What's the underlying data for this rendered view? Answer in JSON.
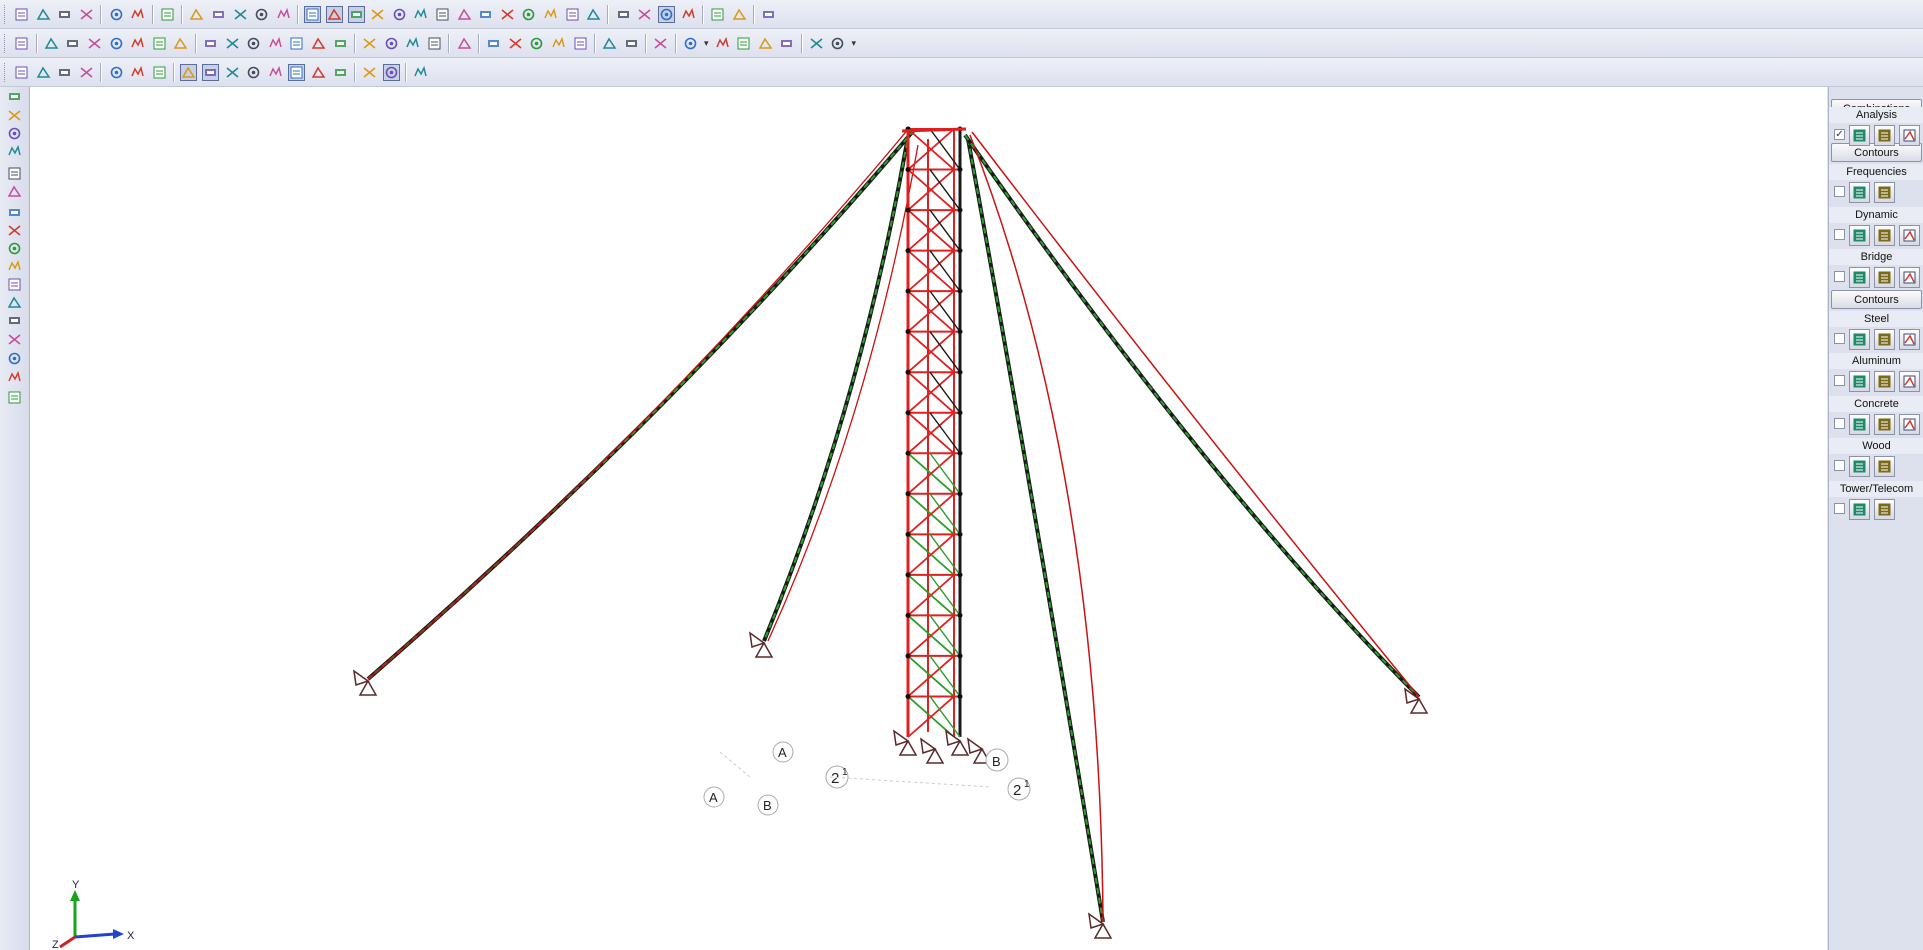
{
  "toolbars": {
    "row1_icons": [
      "new-file-icon",
      "open-file-icon",
      "save-icon",
      "print-icon",
      "undo-icon",
      "redo-icon",
      "modify-icon",
      "2d-3d-icon",
      "load-icon",
      "member-icon",
      "render-icon",
      "plate-view-icon",
      "selection-view-icon",
      "member-view-icon",
      "table-icon",
      "section-icon",
      "joint-icon",
      "spring-icon",
      "support-icon",
      "plate-icon",
      "solid-icon",
      "wall-icon",
      "diaphragm-icon",
      "load-case-icon",
      "panel-icon",
      "measure-icon",
      "member-label-icon",
      "rotate-icon",
      "view-options-icon",
      "global-icon",
      "toggle-icon",
      "model-merge-icon",
      "help-icon"
    ],
    "row2_icons": [
      "spreadsheet-icon",
      "draw-member-icon",
      "draw-plate-icon",
      "draw-joint-icon",
      "draw-support-icon",
      "draw-load-icon",
      "draw-area-icon",
      "draw-solid-icon",
      "delete-member-icon",
      "delete-plate-icon",
      "delete-joint-icon",
      "delete-support-icon",
      "delete-load-icon",
      "delete-area-icon",
      "delete-all-icon",
      "grid-icon",
      "snap-icon",
      "cut-icon",
      "copy-icon",
      "paste-icon",
      "member-rotate-icon",
      "distributed-load-icon",
      "point-load-icon",
      "surface-load-icon",
      "moving-load-icon",
      "area-load-icon",
      "thermal-load-icon",
      "color-palette-icon",
      "display-detail-icon",
      "tag-icon",
      "tag-2-icon",
      "tag-3-icon",
      "tag-4-icon",
      "tag-5-icon",
      "material-icon"
    ],
    "row3_icons": [
      "select-box-icon",
      "select-all-icon",
      "unselect-all-icon",
      "invert-selection-icon",
      "save-selection-icon",
      "lock-selection-icon",
      "range-selection-icon",
      "select-pointer-icon",
      "select-line-icon",
      "select-polygon-icon",
      "select-window-icon",
      "select-crossing-icon",
      "select-plate-icon",
      "select-solid-icon",
      "select-link-icon",
      "select-joint-icon",
      "select-member-icon",
      "select-check-icon"
    ]
  },
  "left_toolbar_icons": [
    "pan-hand-icon",
    "globe-view-icon",
    "grid-view-icon",
    "rotate-view-icon",
    "zoom-in-icon",
    "zoom-out-icon",
    "iso-view-icon",
    "front-view-icon",
    "side-view-icon",
    "top-view-icon",
    "redraw-icon",
    "prev-view-icon",
    "cube-view-icon",
    "members-3d-icon",
    "render-model-icon",
    "eye-icon",
    "clone-view-icon"
  ],
  "right_panel": {
    "combinations_label": "Combinations",
    "contours_label_1": "Contours",
    "contours_label_2": "Contours",
    "sections": [
      {
        "label": "Analysis",
        "checked": true,
        "buttons": 3
      },
      {
        "label": "Frequencies",
        "checked": false,
        "buttons": 2
      },
      {
        "label": "Dynamic",
        "checked": false,
        "buttons": 3
      },
      {
        "label": "Bridge",
        "checked": false,
        "buttons": 3
      },
      {
        "label": "Steel",
        "checked": false,
        "buttons": 3
      },
      {
        "label": "Aluminum",
        "checked": false,
        "buttons": 3
      },
      {
        "label": "Concrete",
        "checked": false,
        "buttons": 3
      },
      {
        "label": "Wood",
        "checked": false,
        "buttons": 2
      },
      {
        "label": "Tower/Telecom",
        "checked": false,
        "buttons": 2
      }
    ],
    "check_mark": "✓"
  },
  "model": {
    "grid_labels": {
      "g2a": "2",
      "g1a": "1",
      "gA1": "A",
      "gB1": "B",
      "gA2": "A",
      "gB2": "B",
      "g2b": "2",
      "g1b": "1"
    },
    "axis": {
      "x": "X",
      "y": "Y",
      "z": "Z"
    },
    "colors": {
      "member_red": "#e02020",
      "member_green": "#2aa02a",
      "member_dark": "#1a1a1a",
      "cable_red": "#cc1111"
    }
  }
}
